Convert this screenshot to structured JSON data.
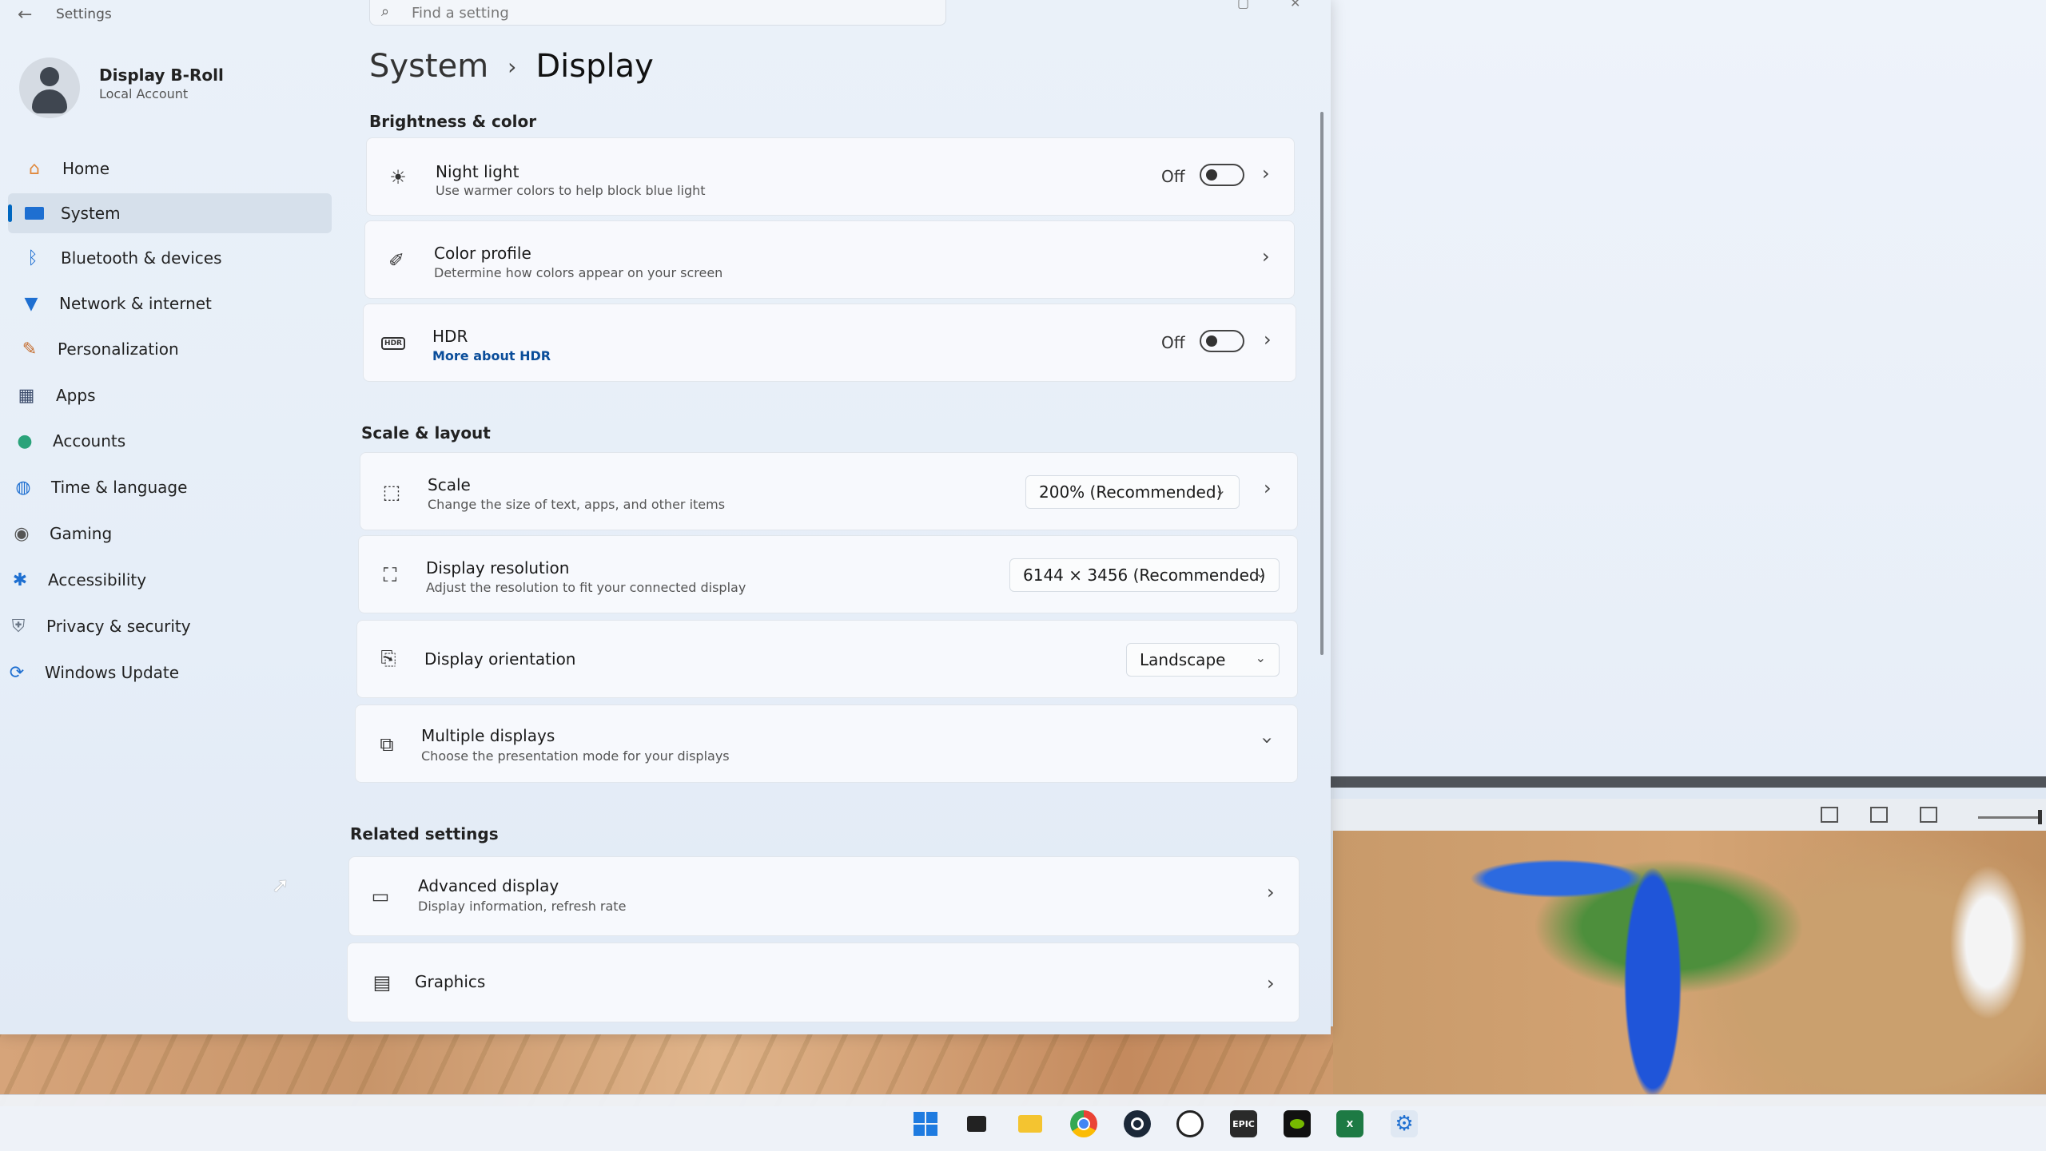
{
  "window": {
    "title": "Settings"
  },
  "search": {
    "placeholder": "Find a setting"
  },
  "account": {
    "name": "Display B-Roll",
    "type": "Local Account"
  },
  "sidebar": {
    "items": [
      {
        "label": "Home",
        "icon": "home-icon"
      },
      {
        "label": "System",
        "icon": "system-icon",
        "active": true
      },
      {
        "label": "Bluetooth & devices",
        "icon": "bluetooth-icon"
      },
      {
        "label": "Network & internet",
        "icon": "wifi-icon"
      },
      {
        "label": "Personalization",
        "icon": "brush-icon"
      },
      {
        "label": "Apps",
        "icon": "apps-icon"
      },
      {
        "label": "Accounts",
        "icon": "accounts-icon"
      },
      {
        "label": "Time & language",
        "icon": "globe-clock-icon"
      },
      {
        "label": "Gaming",
        "icon": "gamepad-icon"
      },
      {
        "label": "Accessibility",
        "icon": "accessibility-icon"
      },
      {
        "label": "Privacy & security",
        "icon": "shield-icon"
      },
      {
        "label": "Windows Update",
        "icon": "update-icon"
      }
    ]
  },
  "breadcrumb": {
    "parent": "System",
    "separator": "›",
    "current": "Display"
  },
  "sections": {
    "brightness": "Brightness & color",
    "scale": "Scale & layout",
    "related": "Related settings"
  },
  "night_light": {
    "title": "Night light",
    "subtitle": "Use warmer colors to help block blue light",
    "state": "Off",
    "enabled": false
  },
  "color_profile": {
    "title": "Color profile",
    "subtitle": "Determine how colors appear on your screen"
  },
  "hdr": {
    "title": "HDR",
    "link": "More about HDR",
    "state": "Off",
    "enabled": false
  },
  "scale": {
    "title": "Scale",
    "subtitle": "Change the size of text, apps, and other items",
    "value": "200% (Recommended)"
  },
  "resolution": {
    "title": "Display resolution",
    "subtitle": "Adjust the resolution to fit your connected display",
    "value": "6144 × 3456 (Recommended)"
  },
  "orientation": {
    "title": "Display orientation",
    "value": "Landscape"
  },
  "multiple_displays": {
    "title": "Multiple displays",
    "subtitle": "Choose the presentation mode for your displays"
  },
  "advanced_display": {
    "title": "Advanced display",
    "subtitle": "Display information, refresh rate"
  },
  "graphics": {
    "title": "Graphics"
  },
  "taskbar": {
    "apps": [
      "start",
      "task-view",
      "file-explorer",
      "chrome",
      "steam",
      "ubisoft",
      "epic-games",
      "nvidia",
      "excel",
      "settings"
    ],
    "epic_label": "EPIC",
    "excel_label": "X"
  },
  "colors": {
    "accent": "#0067c0",
    "window_bg": "#e6eef8",
    "card_bg": "#f8fafd"
  }
}
